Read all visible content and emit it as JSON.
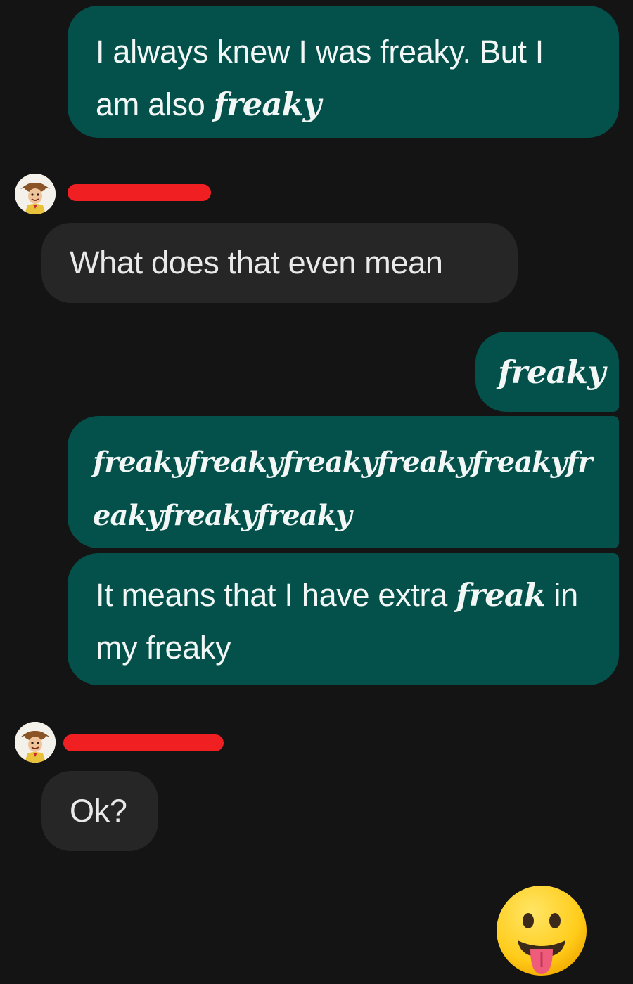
{
  "conversation": {
    "messages": [
      {
        "direction": "outgoing",
        "text_plain": "I always knew I was freaky. But I am also ",
        "text_styled": "freaky"
      },
      {
        "direction": "incoming",
        "sender": {
          "avatar_icon": "woody-avatar-icon",
          "name_redacted": true
        },
        "text": "What does that even mean"
      },
      {
        "direction": "outgoing",
        "text_styled": "freaky"
      },
      {
        "direction": "outgoing",
        "text_styled": "freakyfreakyfreakyfreakyfreakyfreakyfreakyfreaky"
      },
      {
        "direction": "outgoing",
        "text_plain": "It means that I have extra ",
        "text_styled": "freak",
        "text_plain_after": " in my freaky"
      },
      {
        "direction": "incoming",
        "sender": {
          "avatar_icon": "woody-avatar-icon",
          "name_redacted": true
        },
        "text": "Ok?"
      }
    ],
    "reaction": {
      "emoji": "😛",
      "icon": "tongue-out-emoji-icon"
    }
  },
  "colors": {
    "background": "#141414",
    "outgoing_bubble": "#03514a",
    "incoming_bubble": "#262626",
    "redaction": "#f01f22"
  }
}
